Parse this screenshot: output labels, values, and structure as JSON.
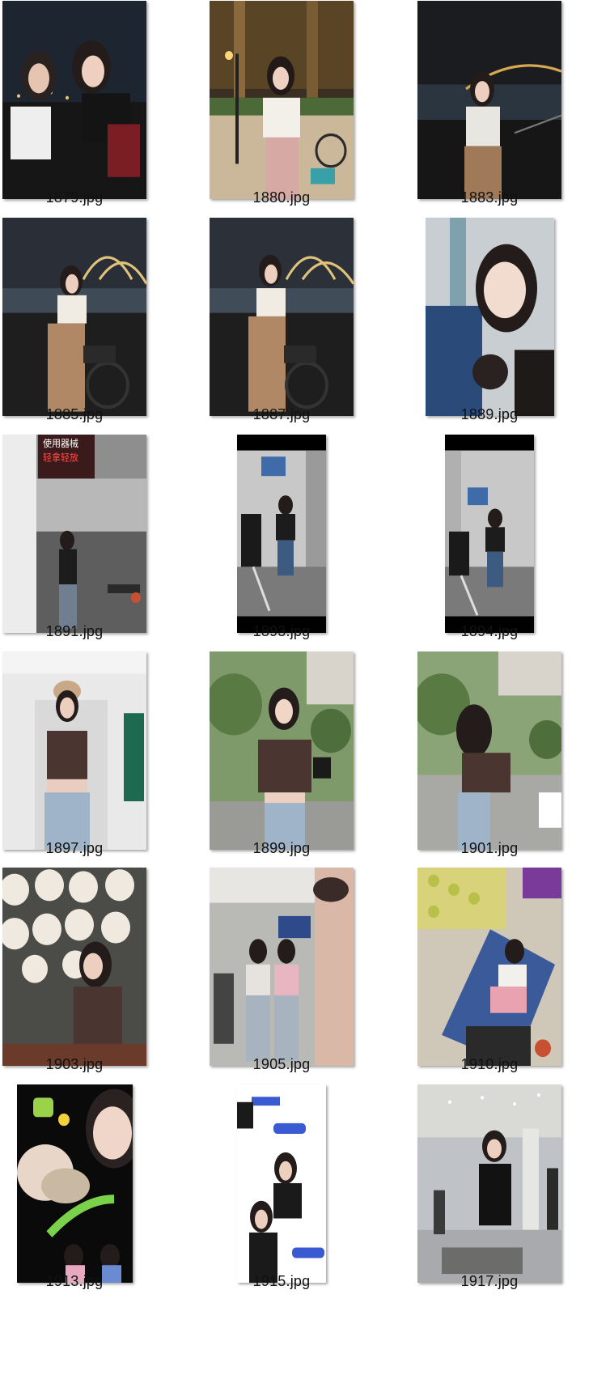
{
  "files": [
    {
      "name": "1879.jpg",
      "scene": "night-river-two-people"
    },
    {
      "name": "1880.jpg",
      "scene": "night-street-bicycle"
    },
    {
      "name": "1883.jpg",
      "scene": "night-bridge-river"
    },
    {
      "name": "1885.jpg",
      "scene": "night-bridge-bicycle"
    },
    {
      "name": "1887.jpg",
      "scene": "night-bridge-bicycle"
    },
    {
      "name": "1889.jpg",
      "scene": "denim-selfie-indoor"
    },
    {
      "name": "1891.jpg",
      "scene": "gym-mirror"
    },
    {
      "name": "1893.jpg",
      "scene": "gym-machine"
    },
    {
      "name": "1894.jpg",
      "scene": "gym-machine"
    },
    {
      "name": "1897.jpg",
      "scene": "store-beanie"
    },
    {
      "name": "1899.jpg",
      "scene": "garden-camera"
    },
    {
      "name": "1901.jpg",
      "scene": "garden-back"
    },
    {
      "name": "1903.jpg",
      "scene": "restaurant-plates"
    },
    {
      "name": "1905.jpg",
      "scene": "mall-mirror"
    },
    {
      "name": "1910.jpg",
      "scene": "yoga-mat-overhead"
    },
    {
      "name": "1913.jpg",
      "scene": "sticker-collage-dark"
    },
    {
      "name": "1915.jpg",
      "scene": "sticker-collage-white"
    },
    {
      "name": "1917.jpg",
      "scene": "airport-terminal"
    }
  ]
}
